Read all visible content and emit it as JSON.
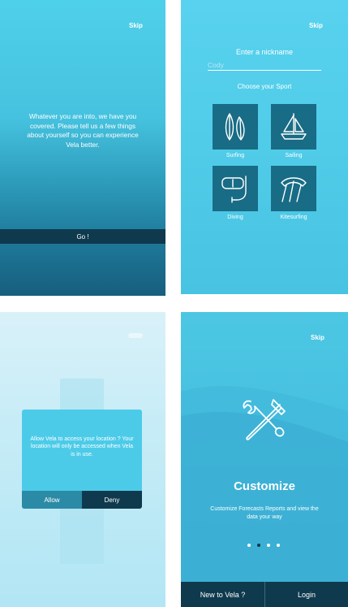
{
  "screen1": {
    "skip": "Skip",
    "intro": "Whatever you are into, we have you covered. Please tell us a few things about yourself so you can experience Vela better.",
    "go": "Go !"
  },
  "screen2": {
    "skip": "Skip",
    "title": "Enter a nickname",
    "nickname_placeholder": "Cody",
    "choose": "Choose your Sport",
    "sports": [
      {
        "label": "Surfing",
        "icon": "surfboard-icon"
      },
      {
        "label": "Sailing",
        "icon": "sailboat-icon"
      },
      {
        "label": "Diving",
        "icon": "diving-mask-icon"
      },
      {
        "label": "Kitesurfing",
        "icon": "kite-icon"
      }
    ]
  },
  "screen3": {
    "dialog_text": "Allow Vela to access your location ? Your location will only be accessed when Vela is in use.",
    "allow": "Allow",
    "deny": "Deny"
  },
  "screen4": {
    "skip": "Skip",
    "heading": "Customize",
    "subtext": "Customize Forecasts Reports and view the data your way",
    "icon": "hammer-wrench-icon",
    "page_indicator": {
      "total": 4,
      "active": 2
    },
    "new_to_vela": "New to Vela ?",
    "login": "Login"
  },
  "colors": {
    "dark_navy": "#0f3a4e",
    "accent_cyan": "#4ccbe9",
    "tile_teal": "#186c85"
  }
}
